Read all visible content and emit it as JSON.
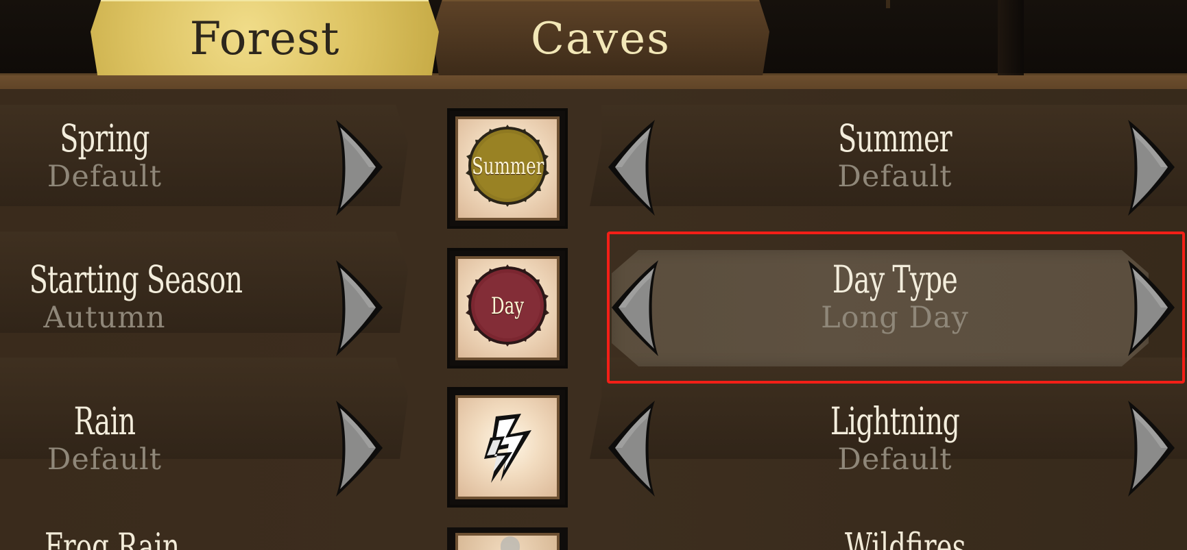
{
  "tabs": [
    {
      "label": "Forest",
      "active": true
    },
    {
      "label": "Caves",
      "active": false
    }
  ],
  "settings": {
    "spring": {
      "label": "Spring",
      "value": "Default"
    },
    "summer": {
      "label": "Summer",
      "value": "Default"
    },
    "starting_season": {
      "label": "Starting Season",
      "value": "Autumn"
    },
    "day_type": {
      "label": "Day Type",
      "value": "Long Day"
    },
    "rain": {
      "label": "Rain",
      "value": "Default"
    },
    "lightning": {
      "label": "Lightning",
      "value": "Default"
    }
  },
  "icons": {
    "summer_badge": {
      "name": "summer-badge-icon",
      "label": "Summer",
      "color": "#8f7921"
    },
    "day_badge": {
      "name": "day-badge-icon",
      "label": "Day",
      "color": "#7b2630"
    },
    "lightning": {
      "name": "lightning-icon"
    }
  },
  "colors": {
    "active_tab": "#ddc362",
    "inactive_tab": "#4b351f",
    "highlight": "#f31f17",
    "value_text": "#8f8779"
  }
}
